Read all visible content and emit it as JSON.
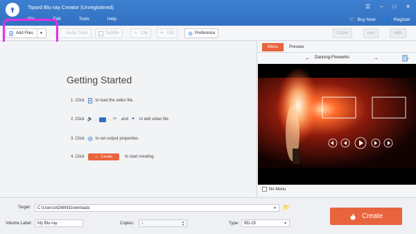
{
  "app": {
    "title": "Tipard Blu-ray Creator (Unregistered)",
    "menu": [
      "File",
      "Edit",
      "Tools",
      "Help"
    ],
    "buy_now": "Buy Now",
    "register": "Register",
    "accent": "#3271c2"
  },
  "toolbar": {
    "add_files": "Add Files",
    "audio_track": "Audio Track",
    "subtitle": "Subtitle",
    "clip": "Clip",
    "edit": "Edit",
    "preference": "Preference",
    "gpu": [
      "CUDA",
      "intel",
      "AMD"
    ]
  },
  "getting_started": {
    "title": "Getting Started",
    "step1_prefix": "1. Click",
    "step1_suffix": "to load the video file.",
    "step2_prefix": "2. Click",
    "step2_mid": "and",
    "step2_suffix": "to edit video file.",
    "step3_prefix": "3. Click",
    "step3_suffix": "to set output properties.",
    "step4_prefix": "4. Click",
    "step4_button": "Create",
    "step4_suffix": "to start creating."
  },
  "right_panel": {
    "tabs": [
      "Menu",
      "Preview"
    ],
    "template_name": "Dancing-Fireworks",
    "no_menu": "No Menu"
  },
  "bottom": {
    "target_label": "Target:",
    "target_value": "C:\\Users\\ADMIN\\Downloads",
    "volume_label": "Volume Label:",
    "volume_value": "My Blu-ray",
    "copies_label": "Copies:",
    "copies_value": "1",
    "type_label": "Type:",
    "type_value": "BD-25",
    "create": "Create",
    "create_color": "#e8643c"
  }
}
